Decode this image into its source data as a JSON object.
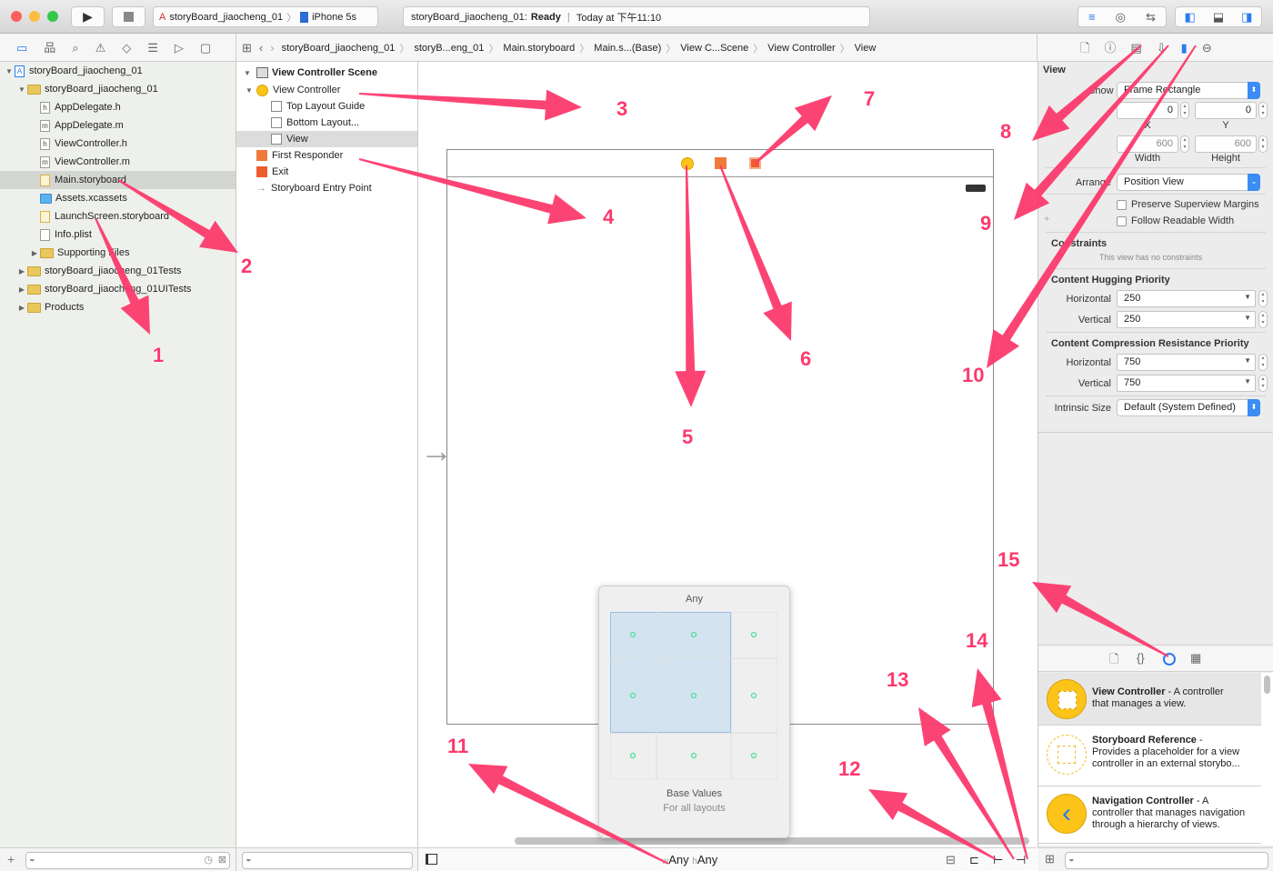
{
  "toolbar": {
    "scheme": "storyBoard_jiaocheng_01",
    "device": "iPhone 5s",
    "status_project": "storyBoard_jiaocheng_01:",
    "status_state": "Ready",
    "status_time": "Today at 下午11:10"
  },
  "jumpbar": [
    "storyBoard_jiaocheng_01",
    "storyB...eng_01",
    "Main.storyboard",
    "Main.s...(Base)",
    "View C...Scene",
    "View Controller",
    "View"
  ],
  "navigator": {
    "items": [
      {
        "label": "storyBoard_jiaocheng_01",
        "type": "project",
        "level": 0,
        "open": true
      },
      {
        "label": "storyBoard_jiaocheng_01",
        "type": "folder",
        "level": 1,
        "open": true
      },
      {
        "label": "AppDelegate.h",
        "type": "h",
        "level": 2
      },
      {
        "label": "AppDelegate.m",
        "type": "m",
        "level": 2
      },
      {
        "label": "ViewController.h",
        "type": "h",
        "level": 2
      },
      {
        "label": "ViewController.m",
        "type": "m",
        "level": 2
      },
      {
        "label": "Main.storyboard",
        "type": "sb",
        "level": 2,
        "selected": true
      },
      {
        "label": "Assets.xcassets",
        "type": "assets",
        "level": 2
      },
      {
        "label": "LaunchScreen.storyboard",
        "type": "sb",
        "level": 2
      },
      {
        "label": "Info.plist",
        "type": "plist",
        "level": 2
      },
      {
        "label": "Supporting Files",
        "type": "folder",
        "level": 2,
        "closed": true
      },
      {
        "label": "storyBoard_jiaocheng_01Tests",
        "type": "folder",
        "level": 1,
        "closed": true
      },
      {
        "label": "storyBoard_jiaocheng_01UITests",
        "type": "folder",
        "level": 1,
        "closed": true
      },
      {
        "label": "Products",
        "type": "folder",
        "level": 1,
        "closed": true
      }
    ]
  },
  "outline": {
    "scene": "View Controller Scene",
    "items": [
      {
        "label": "View Controller",
        "level": 1,
        "icon": "vc"
      },
      {
        "label": "Top Layout Guide",
        "level": 2,
        "icon": "box"
      },
      {
        "label": "Bottom Layout...",
        "level": 2,
        "icon": "box"
      },
      {
        "label": "View",
        "level": 2,
        "icon": "box",
        "selected": true
      },
      {
        "label": "First Responder",
        "level": 1,
        "icon": "cube"
      },
      {
        "label": "Exit",
        "level": 1,
        "icon": "exit"
      },
      {
        "label": "Storyboard Entry Point",
        "level": 1,
        "icon": "arrow"
      }
    ]
  },
  "size_popover": {
    "title": "Any",
    "base": "Base Values",
    "sub": "For all layouts"
  },
  "size_class": {
    "w_prefix": "w",
    "w": "Any",
    "h_prefix": "h",
    "h": "Any"
  },
  "inspector": {
    "section": "View",
    "show_label": "Show",
    "show_value": "Frame Rectangle",
    "x": "0",
    "y": "0",
    "x_label": "X",
    "y_label": "Y",
    "width": "600",
    "height": "600",
    "width_label": "Width",
    "height_label": "Height",
    "arrange_label": "Arrange",
    "arrange_value": "Position View",
    "preserve": "Preserve Superview Margins",
    "readable": "Follow Readable Width",
    "constraints_title": "Constraints",
    "constraints_note": "This view has no constraints",
    "hugging_title": "Content Hugging Priority",
    "compression_title": "Content Compression Resistance Priority",
    "horizontal": "Horizontal",
    "vertical": "Vertical",
    "hug_h": "250",
    "hug_v": "250",
    "comp_h": "750",
    "comp_v": "750",
    "intrinsic_label": "Intrinsic Size",
    "intrinsic_value": "Default (System Defined)"
  },
  "library": [
    {
      "title": "View Controller",
      "desc1": " - A controller",
      "desc2": "that manages a view.",
      "desc3": ""
    },
    {
      "title": "Storyboard Reference",
      "desc1": " -",
      "desc2": "Provides a placeholder for a view",
      "desc3": "controller in an external storybo..."
    },
    {
      "title": "Navigation Controller",
      "desc1": " - A",
      "desc2": "controller that manages navigation",
      "desc3": "through a hierarchy of views."
    }
  ],
  "annotations": [
    "1",
    "2",
    "3",
    "4",
    "5",
    "6",
    "7",
    "8",
    "9",
    "10",
    "11",
    "12",
    "13",
    "14",
    "15"
  ],
  "colors": {
    "accent": "#3b8cf5",
    "annotation": "#fc3a6d",
    "folder": "#e9c75b",
    "vc_yellow": "#fcc419"
  }
}
